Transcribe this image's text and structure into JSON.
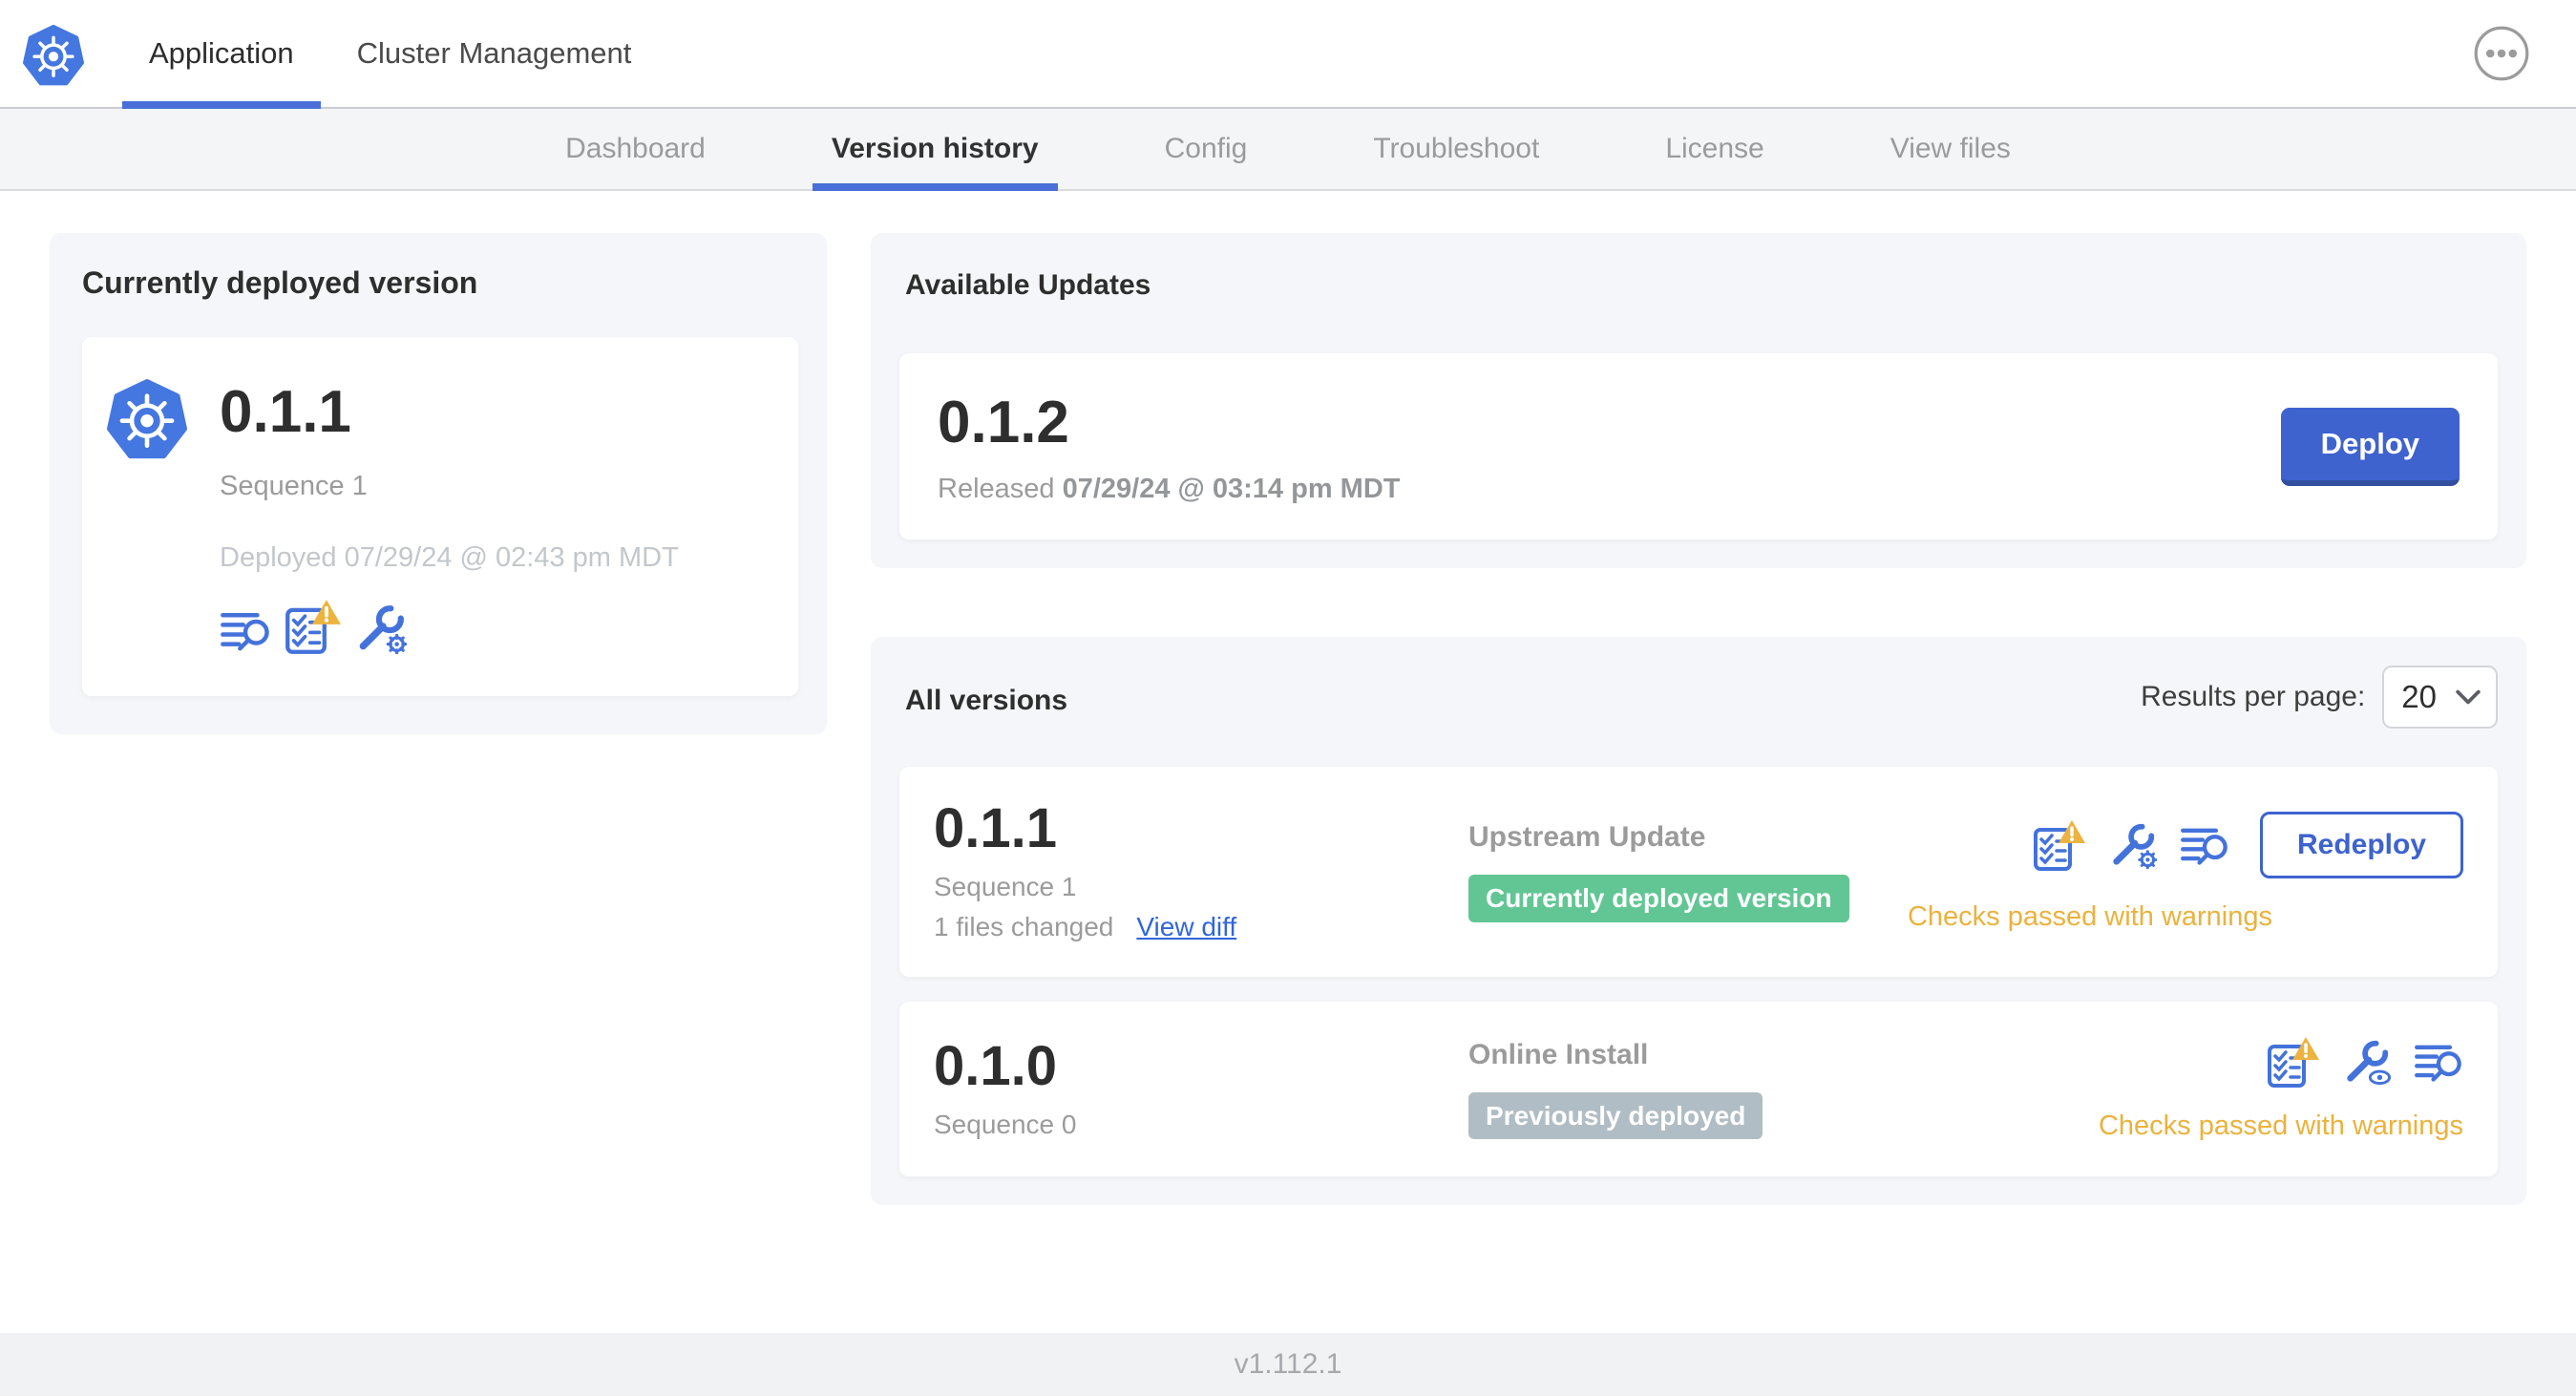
{
  "colors": {
    "accent_blue": "#3e63cf",
    "logo_blue": "#4577e0",
    "icon_blue": "#4472db",
    "success_green": "#61c694",
    "neutral_badge_gray": "#b0bdc4",
    "warning_orange": "#ebb23c",
    "subnav_bg": "#f4f5f7",
    "card_bg": "#f5f6f9"
  },
  "top_nav": {
    "logo_icon": "kubernetes-logo-icon",
    "more_button_icon": "ellipsis-menu-icon",
    "tabs": [
      {
        "label": "Application",
        "active": true
      },
      {
        "label": "Cluster Management",
        "active": false
      }
    ]
  },
  "sub_nav": {
    "items": [
      {
        "label": "Dashboard",
        "active": false
      },
      {
        "label": "Version history",
        "active": true
      },
      {
        "label": "Config",
        "active": false
      },
      {
        "label": "Troubleshoot",
        "active": false
      },
      {
        "label": "License",
        "active": false
      },
      {
        "label": "View files",
        "active": false
      }
    ]
  },
  "current_version_card": {
    "title": "Currently deployed version",
    "app_icon": "kubernetes-app-icon",
    "version": "0.1.1",
    "sequence": "Sequence 1",
    "deployed": "Deployed 07/29/24 @ 02:43 pm MDT",
    "icons": [
      "deploy-logs-icon",
      "preflight-checks-warning-icon",
      "edit-config-icon"
    ]
  },
  "available_updates_card": {
    "title": "Available Updates",
    "version": "0.1.2",
    "released_prefix": "Released ",
    "released_date": "07/29/24 @ 03:14 pm MDT",
    "deploy_button": "Deploy"
  },
  "all_versions_card": {
    "title": "All versions",
    "results_per_page_label": "Results per page:",
    "results_per_page_value": "20",
    "rows": [
      {
        "version": "0.1.1",
        "sequence": "Sequence 1",
        "files_changed": "1 files changed",
        "view_diff_link": "View diff",
        "source": "Upstream Update",
        "badge": {
          "label": "Currently deployed version",
          "color": "green"
        },
        "icons": [
          "preflight-checks-warning-icon",
          "edit-config-icon",
          "deploy-logs-icon"
        ],
        "action_button": "Redeploy",
        "status": {
          "text": "Checks passed with warnings",
          "type": "warning"
        }
      },
      {
        "version": "0.1.0",
        "sequence": "Sequence 0",
        "source": "Online Install",
        "badge": {
          "label": "Previously deployed",
          "color": "gray"
        },
        "icons": [
          "preflight-checks-warning-icon",
          "view-config-icon",
          "deploy-logs-icon"
        ],
        "status": {
          "text": "Checks passed with warnings",
          "type": "warning"
        }
      }
    ]
  },
  "footer": {
    "version_label": "v1.112.1"
  }
}
